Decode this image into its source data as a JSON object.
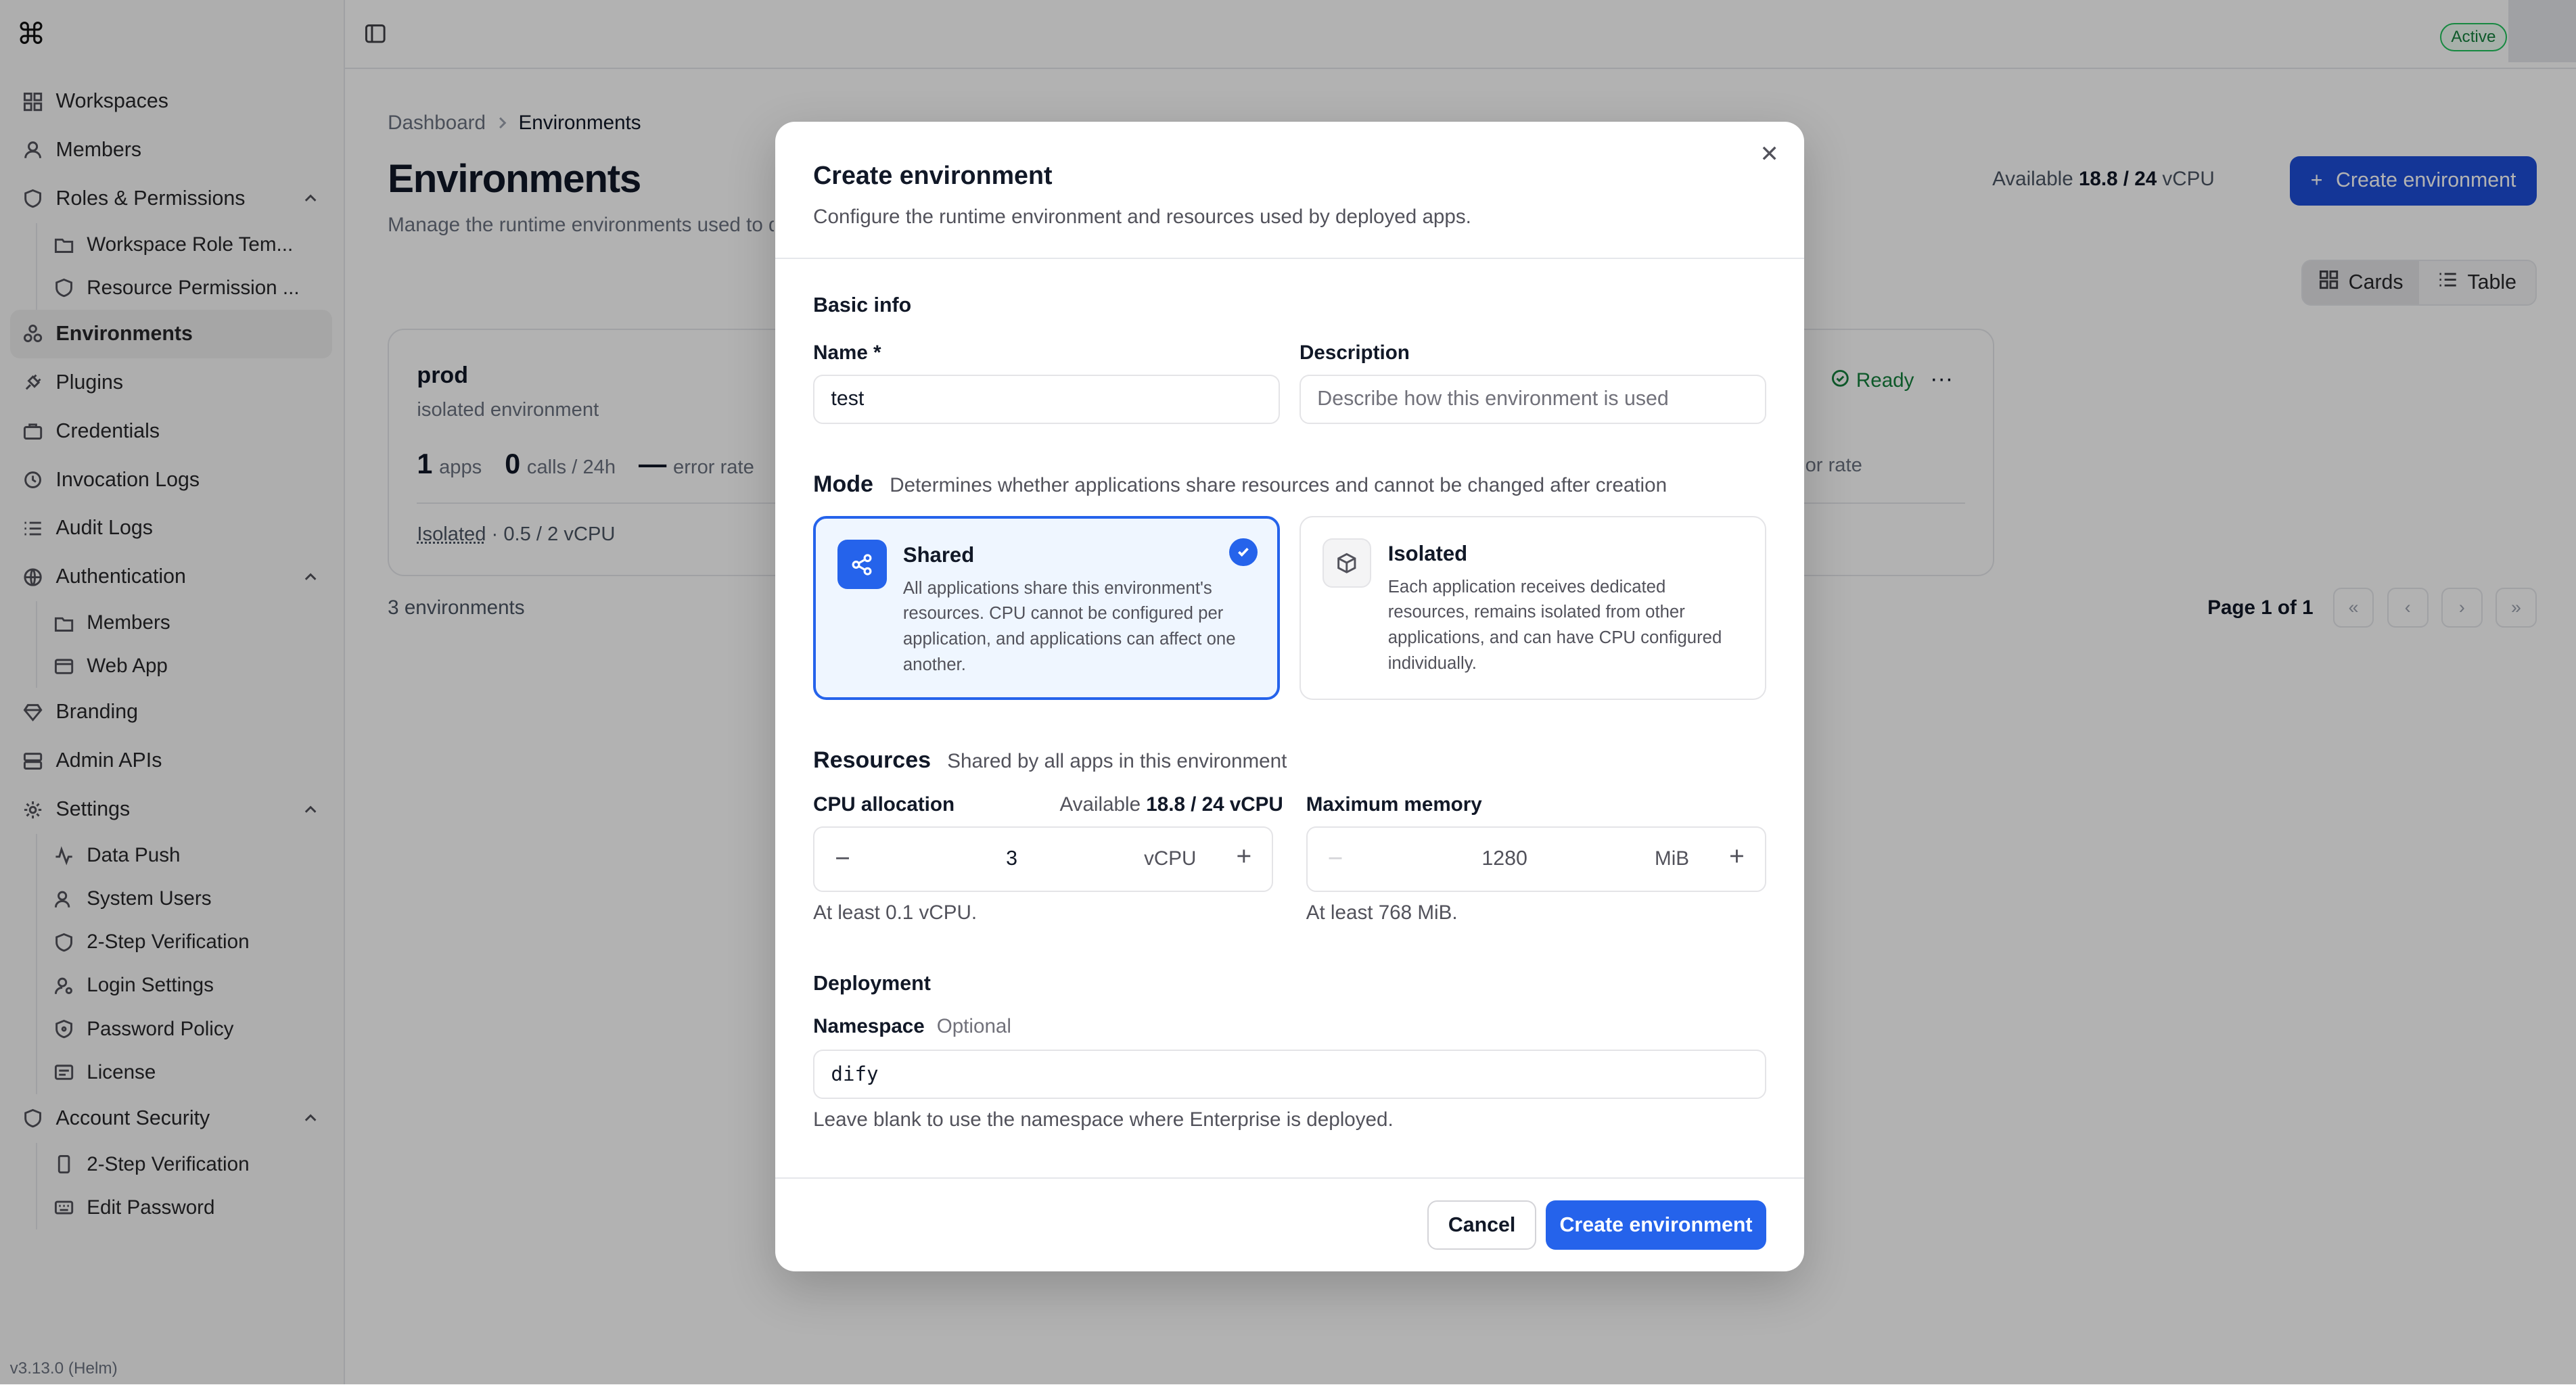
{
  "app": {
    "version": "v3.13.0 (Helm)",
    "status_badge": "Active"
  },
  "sidebar": {
    "items": [
      {
        "label": "Workspaces",
        "icon": "grid-icon"
      },
      {
        "label": "Members",
        "icon": "user-icon"
      },
      {
        "label": "Roles & Permissions",
        "icon": "shield-icon",
        "expanded": true,
        "children": [
          {
            "label": "Workspace Role Tem...",
            "icon": "folder-icon"
          },
          {
            "label": "Resource Permission ...",
            "icon": "shield-icon"
          }
        ]
      },
      {
        "label": "Environments",
        "icon": "cluster-icon",
        "active": true
      },
      {
        "label": "Plugins",
        "icon": "plug-icon"
      },
      {
        "label": "Credentials",
        "icon": "briefcase-icon"
      },
      {
        "label": "Invocation Logs",
        "icon": "history-icon"
      },
      {
        "label": "Audit Logs",
        "icon": "list-icon"
      },
      {
        "label": "Authentication",
        "icon": "globe-icon",
        "expanded": true,
        "children": [
          {
            "label": "Members",
            "icon": "folder-icon"
          },
          {
            "label": "Web App",
            "icon": "window-icon"
          }
        ]
      },
      {
        "label": "Branding",
        "icon": "gem-icon"
      },
      {
        "label": "Admin APIs",
        "icon": "server-icon"
      },
      {
        "label": "Settings",
        "icon": "gear-icon",
        "expanded": true,
        "children": [
          {
            "label": "Data Push",
            "icon": "activity-icon"
          },
          {
            "label": "System Users",
            "icon": "users-icon"
          },
          {
            "label": "2-Step Verification",
            "icon": "shield-icon"
          },
          {
            "label": "Login Settings",
            "icon": "user-cog-icon"
          },
          {
            "label": "Password Policy",
            "icon": "shield-lock-icon"
          },
          {
            "label": "License",
            "icon": "license-icon"
          }
        ]
      },
      {
        "label": "Account Security",
        "icon": "shield-icon",
        "expanded": true,
        "children": [
          {
            "label": "2-Step Verification",
            "icon": "phone-icon"
          },
          {
            "label": "Edit Password",
            "icon": "keyboard-icon"
          }
        ]
      }
    ]
  },
  "breadcrumb": {
    "parent": "Dashboard",
    "current": "Environments"
  },
  "page": {
    "title": "Environments",
    "subtitle": "Manage the runtime environments used to de",
    "available_prefix": "Available",
    "available_value": "18.8 / 24",
    "available_unit": "vCPU",
    "create_button": "Create environment",
    "view_cards": "Cards",
    "view_table": "Table",
    "count": "3 environments",
    "pager_label": "Page 1 of 1"
  },
  "env_card": {
    "name": "prod",
    "description": "isolated environment",
    "apps_value": "1",
    "apps_label": "apps",
    "calls_value": "0",
    "calls_label": "calls / 24h",
    "error_value": "—",
    "error_label": "error rate",
    "footer_mode": "Isolated",
    "footer_cpu": "· 0.5 / 2 vCPU",
    "second_status": "Ready",
    "second_error_label": "or rate"
  },
  "modal": {
    "title": "Create environment",
    "subtitle": "Configure the runtime environment and resources used by deployed apps.",
    "basic_info": "Basic info",
    "name_label": "Name *",
    "name_value": "test",
    "description_label": "Description",
    "description_placeholder": "Describe how this environment is used",
    "mode_title": "Mode",
    "mode_subtitle": "Determines whether applications share resources and cannot be changed after creation",
    "mode_options": [
      {
        "title": "Shared",
        "description": "All applications share this environment's resources. CPU cannot be configured per application, and applications can affect one another.",
        "selected": true
      },
      {
        "title": "Isolated",
        "description": "Each application receives dedicated resources, remains isolated from other applications, and can have CPU configured individually.",
        "selected": false
      }
    ],
    "resources_title": "Resources",
    "resources_subtitle": "Shared by all apps in this environment",
    "cpu_label": "CPU allocation",
    "cpu_available_prefix": "Available",
    "cpu_available_value": "18.8 / 24 vCPU",
    "cpu_value": "3",
    "cpu_unit": "vCPU",
    "cpu_hint": "At least 0.1 vCPU.",
    "memory_label": "Maximum memory",
    "memory_value": "1280",
    "memory_unit": "MiB",
    "memory_hint": "At least 768 MiB.",
    "deployment_title": "Deployment",
    "namespace_label": "Namespace",
    "namespace_optional": "Optional",
    "namespace_value": "dify",
    "namespace_hint": "Leave blank to use the namespace where Enterprise is deployed.",
    "cancel": "Cancel",
    "submit": "Create environment"
  }
}
